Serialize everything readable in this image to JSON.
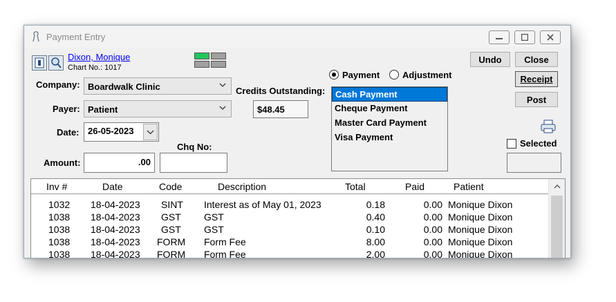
{
  "window": {
    "title": "Payment Entry",
    "controls": [
      "minimize",
      "maximize",
      "close"
    ]
  },
  "patient": {
    "name": "Dixon, Monique",
    "chart_no": "Chart No.: 1017"
  },
  "labels": {
    "company": "Company:",
    "payer": "Payer:",
    "date": "Date:",
    "amount": "Amount:",
    "chq_no": "Chq No:",
    "credits_outstanding": "Credits Outstanding:"
  },
  "values": {
    "company": "Boardwalk Clinic",
    "payer": "Patient",
    "date": "26-05-2023",
    "amount": ".00",
    "chq_no": "",
    "credits_outstanding": "$48.45",
    "selected_box": ""
  },
  "type_options": {
    "payment": "Payment",
    "adjustment": "Adjustment",
    "selected": "payment"
  },
  "payment_methods": [
    "Cash Payment",
    "Cheque Payment",
    "Master Card Payment",
    "Visa Payment"
  ],
  "selected_method_index": 0,
  "buttons": {
    "undo": "Undo",
    "close": "Close",
    "receipt": "Receipt",
    "post": "Post"
  },
  "selected_checkbox": {
    "label": "Selected",
    "checked": false
  },
  "table": {
    "headers": [
      "Inv #",
      "Date",
      "Code",
      "Description",
      "Total",
      "Paid",
      "Patient"
    ],
    "rows": [
      [
        "1032",
        "18-04-2023",
        "SINT",
        "Interest as of May 01, 2023",
        "0.18",
        "0.00",
        "Monique Dixon"
      ],
      [
        "1038",
        "18-04-2023",
        "GST",
        "GST",
        "0.40",
        "0.00",
        "Monique Dixon"
      ],
      [
        "1038",
        "18-04-2023",
        "GST",
        "GST",
        "0.10",
        "0.00",
        "Monique Dixon"
      ],
      [
        "1038",
        "18-04-2023",
        "FORM",
        "Form Fee",
        "8.00",
        "0.00",
        "Monique Dixon"
      ],
      [
        "1038",
        "18-04-2023",
        "FORM",
        "Form Fee",
        "2.00",
        "0.00",
        "Monique Dixon"
      ]
    ]
  },
  "colors": {
    "selection": "#0078d7",
    "status_green": "#22c55e",
    "link": "#0000ee"
  }
}
